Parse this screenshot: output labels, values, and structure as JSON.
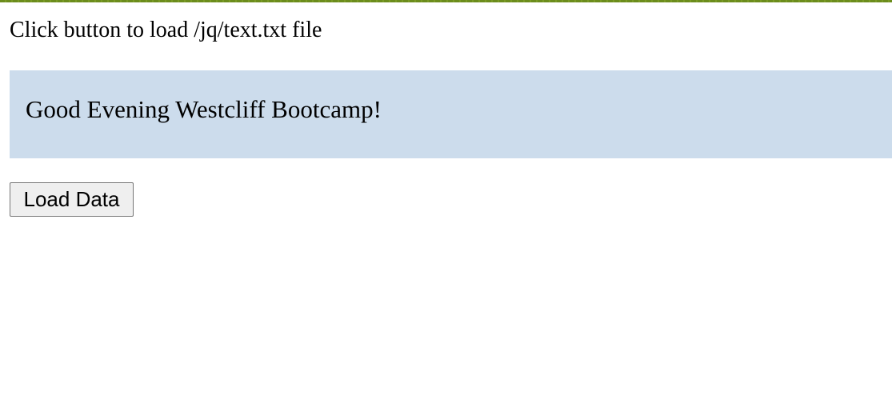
{
  "page": {
    "instruction": "Click button to load /jq/text.txt file",
    "output_text": "Good Evening Westcliff Bootcamp!",
    "load_button_label": "Load Data"
  },
  "colors": {
    "top_border": "#6b8c1c",
    "output_background": "#ccdcec",
    "button_background": "#efefef",
    "button_border": "#767676"
  }
}
